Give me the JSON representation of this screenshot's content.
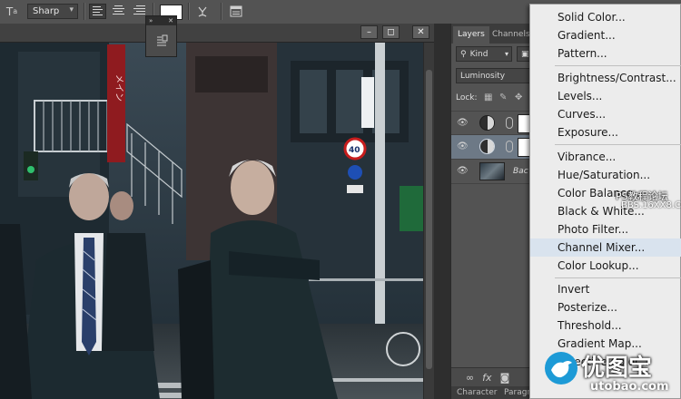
{
  "options_bar": {
    "text_tool_icon": "T",
    "antialias_value": "Sharp",
    "align_buttons": [
      "align-left",
      "align-center",
      "align-right"
    ],
    "text_color": "#ffffff",
    "warp_icon": "warp-text-icon",
    "panels_icon": "character-panel-icon"
  },
  "document": {
    "window_buttons": [
      "–",
      "◻",
      "✕"
    ]
  },
  "mini_panel": {
    "header_left": "»",
    "header_right": "✕"
  },
  "layers_panel": {
    "tabs": [
      "Layers",
      "Channels"
    ],
    "filter_kind": "Kind",
    "blend_mode": "Luminosity",
    "lock_label": "Lock:",
    "layers": [
      {
        "name": "",
        "type": "adjustment"
      },
      {
        "name": "",
        "type": "adjustment",
        "selected": true
      },
      {
        "name": "Bac",
        "type": "background"
      }
    ],
    "bottom_icons": [
      "∞",
      "fx"
    ],
    "bottom_tabs": [
      "Character",
      "Paragraph"
    ]
  },
  "adjustment_menu": {
    "groups": [
      [
        "Solid Color...",
        "Gradient...",
        "Pattern..."
      ],
      [
        "Brightness/Contrast...",
        "Levels...",
        "Curves...",
        "Exposure..."
      ],
      [
        "Vibrance...",
        "Hue/Saturation...",
        "Color Balance...",
        "Black & White...",
        "Photo Filter...",
        "Channel Mixer...",
        "Color Lookup..."
      ],
      [
        "Invert",
        "Posterize...",
        "Threshold...",
        "Gradient Map...",
        "Selective Color..."
      ]
    ],
    "highlighted": "Channel Mixer..."
  },
  "watermark": {
    "line1": "PS教程论坛",
    "line2": "BBS.16XX8.COM",
    "logo_text": "优图宝",
    "logo_url": "utobao.com"
  },
  "photo": {
    "sign_speed": "40"
  }
}
